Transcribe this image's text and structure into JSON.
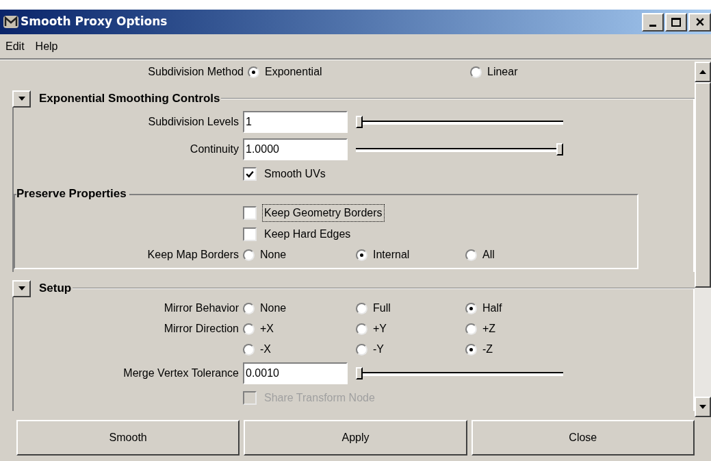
{
  "window": {
    "title": "Smooth Proxy Options"
  },
  "menu": [
    {
      "label": "Edit"
    },
    {
      "label": "Help"
    }
  ],
  "top_rows": [
    {
      "kind": "radio",
      "label": "Subdivision Method",
      "options": [
        {
          "label": "Exponential",
          "selected": true
        },
        {
          "label": "Linear",
          "selected": false
        }
      ]
    }
  ],
  "sections": [
    {
      "title": "Exponential Smoothing Controls",
      "expanded": true,
      "rows": [
        {
          "kind": "field",
          "label": "Subdivision Levels",
          "value": "1",
          "level": 0
        },
        {
          "kind": "field",
          "label": "Continuity",
          "value": "1.0000",
          "level": 1
        },
        {
          "kind": "checkbox",
          "label": "Smooth UVs",
          "checked": true,
          "disabled": false,
          "focused": false
        },
        {
          "kind": "group",
          "title": "Preserve Properties",
          "rows": [
            {
              "kind": "checkbox",
              "label": "Keep Geometry Borders",
              "checked": false,
              "disabled": false,
              "focused": true
            },
            {
              "kind": "checkbox",
              "label": "Keep Hard Edges",
              "checked": false,
              "disabled": false,
              "focused": false
            },
            {
              "kind": "radio",
              "label": "Keep Map Borders",
              "options": [
                {
                  "label": "None",
                  "selected": false
                },
                {
                  "label": "Internal",
                  "selected": true
                },
                {
                  "label": "All",
                  "selected": false
                }
              ]
            }
          ]
        }
      ]
    },
    {
      "title": "Setup",
      "expanded": true,
      "rows": [
        {
          "kind": "radio",
          "label": "Mirror Behavior",
          "options": [
            {
              "label": "None",
              "selected": false
            },
            {
              "label": "Full",
              "selected": false
            },
            {
              "label": "Half",
              "selected": true
            }
          ]
        },
        {
          "kind": "radio",
          "label": "Mirror Direction",
          "options": [
            {
              "label": "+X",
              "selected": false
            },
            {
              "label": "+Y",
              "selected": false
            },
            {
              "label": "+Z",
              "selected": false
            }
          ]
        },
        {
          "kind": "radio",
          "options": [
            {
              "label": "-X",
              "selected": false
            },
            {
              "label": "-Y",
              "selected": false
            },
            {
              "label": "-Z",
              "selected": true
            }
          ]
        },
        {
          "kind": "field",
          "label": "Merge Vertex Tolerance",
          "value": "0.0010",
          "level": 0
        },
        {
          "kind": "checkbox",
          "label": "Share Transform Node",
          "checked": false,
          "disabled": true,
          "focused": false
        }
      ]
    }
  ],
  "buttons": [
    {
      "label": "Smooth"
    },
    {
      "label": "Apply"
    },
    {
      "label": "Close"
    }
  ]
}
